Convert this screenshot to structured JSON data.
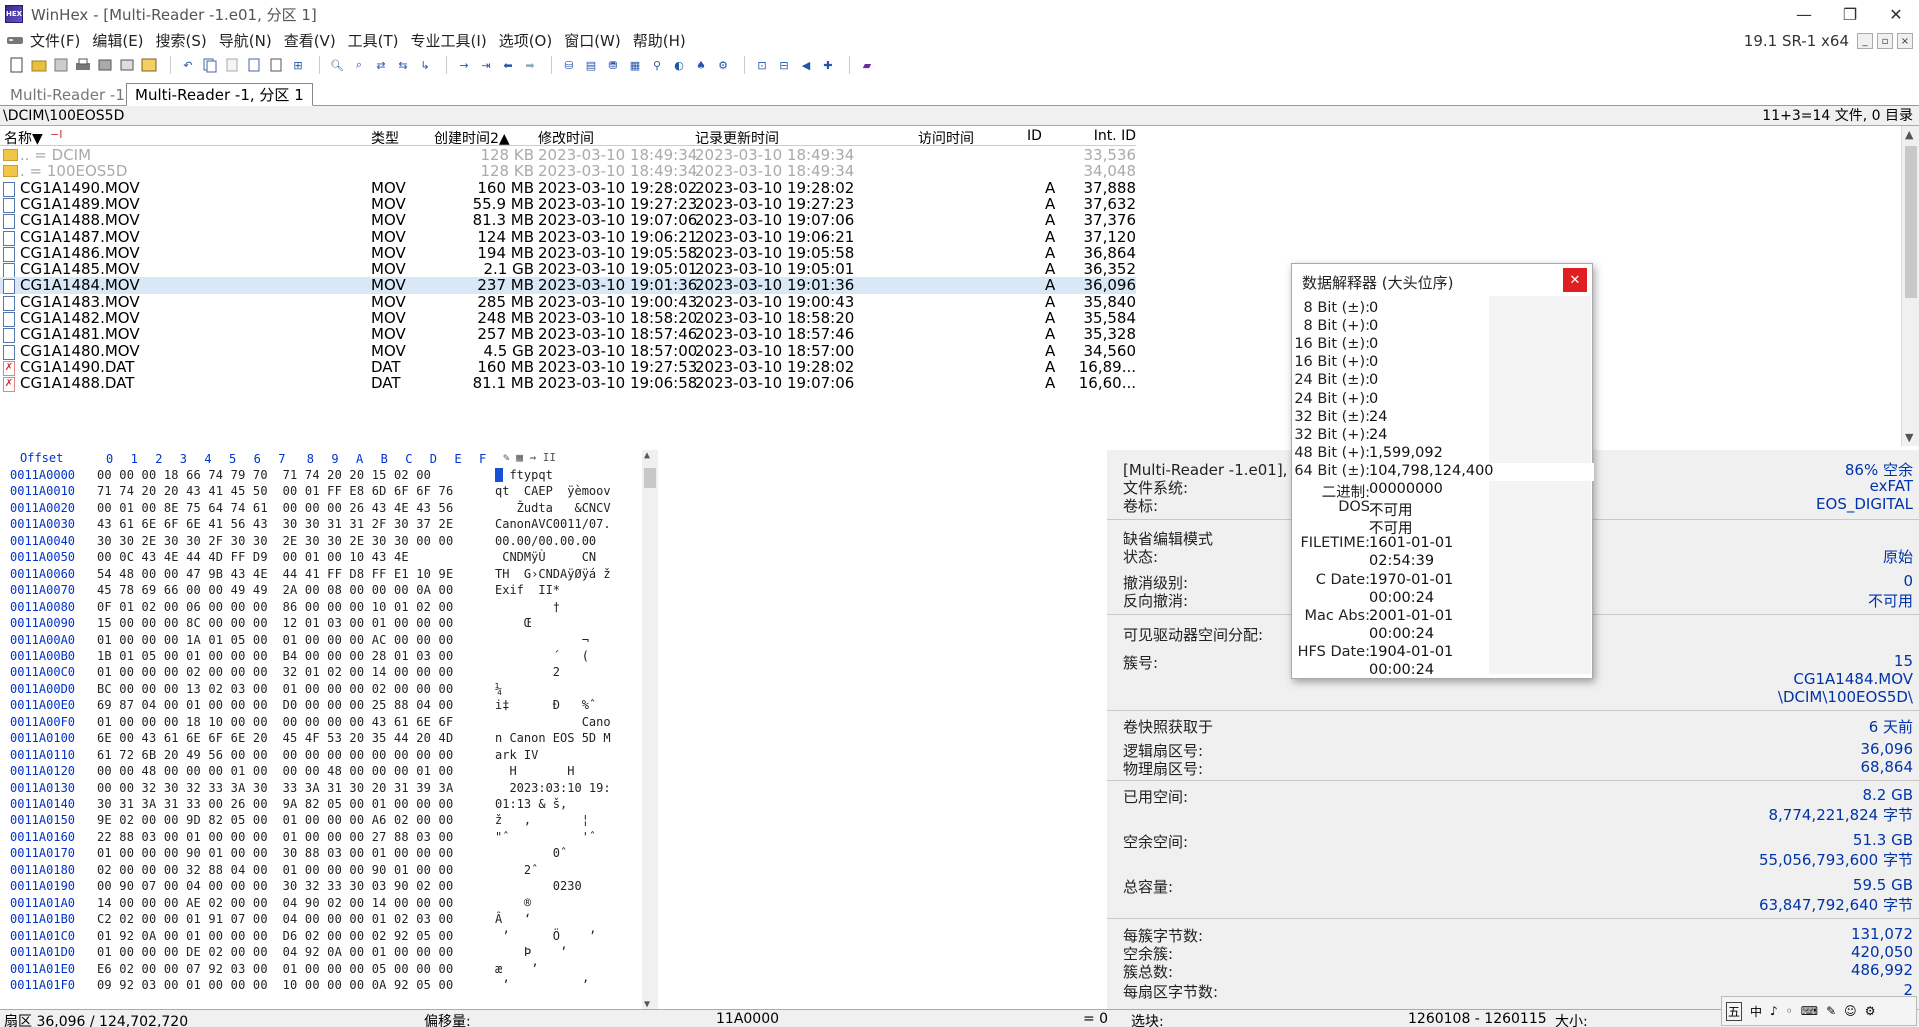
{
  "window": {
    "title": "WinHex - [Multi-Reader -1.e01, 分区 1]",
    "version": "19.1 SR-1 x64",
    "controls": {
      "minimize": "—",
      "restore": "❐",
      "close": "✕"
    }
  },
  "menu": [
    "文件(F)",
    "编辑(E)",
    "搜索(S)",
    "导航(N)",
    "查看(V)",
    "工具(T)",
    "专业工具(I)",
    "选项(O)",
    "窗口(W)",
    "帮助(H)"
  ],
  "tabs": [
    {
      "label": "Multi-Reader -1"
    },
    {
      "label": "Multi-Reader -1, 分区 1"
    }
  ],
  "pathbar": {
    "path": "\\DCIM\\100EOS5D",
    "summary": "11+3=14 文件, 0 目录"
  },
  "filelist": {
    "headers": {
      "name": "名称▼",
      "name_sort": "−I",
      "type": "类型",
      "created": "创建时间2▲",
      "modified": "修改时间",
      "record": "记录更新时间",
      "access": "访问时间",
      "id": "ID",
      "intid": "Int. ID"
    },
    "rows": [
      {
        "icon": "folder",
        "name": "..  =  DCIM",
        "type": "",
        "size": "128 KB",
        "modified": "2023-03-10  18:49:34",
        "record": "2023-03-10  18:49:34",
        "id": "",
        "intid": "33,536",
        "dim": true
      },
      {
        "icon": "folder",
        "name": ".   =  100EOS5D",
        "type": "",
        "size": "128 KB",
        "modified": "2023-03-10  18:49:34",
        "record": "2023-03-10  18:49:34",
        "id": "",
        "intid": "34,048",
        "dim": true
      },
      {
        "icon": "file",
        "name": "CG1A1490.MOV",
        "type": "MOV",
        "size": "160 MB",
        "modified": "2023-03-10  19:28:02",
        "record": "2023-03-10  19:28:02",
        "id": "A",
        "intid": "37,888"
      },
      {
        "icon": "file",
        "name": "CG1A1489.MOV",
        "type": "MOV",
        "size": "55.9 MB",
        "modified": "2023-03-10  19:27:23",
        "record": "2023-03-10  19:27:23",
        "id": "A",
        "intid": "37,632"
      },
      {
        "icon": "file",
        "name": "CG1A1488.MOV",
        "type": "MOV",
        "size": "81.3 MB",
        "modified": "2023-03-10  19:07:06",
        "record": "2023-03-10  19:07:06",
        "id": "A",
        "intid": "37,376"
      },
      {
        "icon": "file",
        "name": "CG1A1487.MOV",
        "type": "MOV",
        "size": "124 MB",
        "modified": "2023-03-10  19:06:21",
        "record": "2023-03-10  19:06:21",
        "id": "A",
        "intid": "37,120"
      },
      {
        "icon": "file",
        "name": "CG1A1486.MOV",
        "type": "MOV",
        "size": "194 MB",
        "modified": "2023-03-10  19:05:58",
        "record": "2023-03-10  19:05:58",
        "id": "A",
        "intid": "36,864"
      },
      {
        "icon": "file",
        "name": "CG1A1485.MOV",
        "type": "MOV",
        "size": "2.1 GB",
        "modified": "2023-03-10  19:05:01",
        "record": "2023-03-10  19:05:01",
        "id": "A",
        "intid": "36,352"
      },
      {
        "icon": "file",
        "name": "CG1A1484.MOV",
        "type": "MOV",
        "size": "237 MB",
        "modified": "2023-03-10  19:01:36",
        "record": "2023-03-10  19:01:36",
        "id": "A",
        "intid": "36,096",
        "selected": true
      },
      {
        "icon": "file",
        "name": "CG1A1483.MOV",
        "type": "MOV",
        "size": "285 MB",
        "modified": "2023-03-10  19:00:43",
        "record": "2023-03-10  19:00:43",
        "id": "A",
        "intid": "35,840"
      },
      {
        "icon": "file",
        "name": "CG1A1482.MOV",
        "type": "MOV",
        "size": "248 MB",
        "modified": "2023-03-10  18:58:20",
        "record": "2023-03-10  18:58:20",
        "id": "A",
        "intid": "35,584"
      },
      {
        "icon": "file",
        "name": "CG1A1481.MOV",
        "type": "MOV",
        "size": "257 MB",
        "modified": "2023-03-10  18:57:46",
        "record": "2023-03-10  18:57:46",
        "id": "A",
        "intid": "35,328"
      },
      {
        "icon": "file",
        "name": "CG1A1480.MOV",
        "type": "MOV",
        "size": "4.5 GB",
        "modified": "2023-03-10  18:57:00",
        "record": "2023-03-10  18:57:00",
        "id": "A",
        "intid": "34,560"
      },
      {
        "icon": "x",
        "name": "CG1A1490.DAT",
        "type": "DAT",
        "size": "160 MB",
        "modified": "2023-03-10  19:27:53",
        "record": "2023-03-10  19:28:02",
        "id": "A",
        "intid": "16,89..."
      },
      {
        "icon": "x",
        "name": "CG1A1488.DAT",
        "type": "DAT",
        "size": "81.1 MB",
        "modified": "2023-03-10  19:06:58",
        "record": "2023-03-10  19:07:06",
        "id": "A",
        "intid": "16,60..."
      }
    ]
  },
  "hex": {
    "header": {
      "offset": "Offset",
      "cols": [
        "0",
        "1",
        "2",
        "3",
        "4",
        "5",
        "6",
        "7",
        "8",
        "9",
        "A",
        "B",
        "C",
        "D",
        "E",
        "F"
      ]
    },
    "rows": [
      {
        "off": "0011A0000",
        "bytes": "00 00 00 18 66 74 79 70  71 74 20 20 15 02 00",
        "ascii": "  ftypqt"
      },
      {
        "off": "0011A0010",
        "bytes": "71 74 20 20 43 41 45 50  00 01 FF E8 6D 6F 6F 76",
        "ascii": "qt  CAEP  ÿèmoov"
      },
      {
        "off": "0011A0020",
        "bytes": "00 01 00 8E 75 64 74 61  00 00 00 26 43 4E 43 56",
        "ascii": "   Žudta   &CNCV"
      },
      {
        "off": "0011A0030",
        "bytes": "43 61 6E 6F 6E 41 56 43  30 30 31 31 2F 30 37 2E",
        "ascii": "CanonAVC0011/07."
      },
      {
        "off": "0011A0040",
        "bytes": "30 30 2E 30 30 2F 30 30  2E 30 30 2E 30 30 00 00",
        "ascii": "00.00/00.00.00"
      },
      {
        "off": "0011A0050",
        "bytes": "00 0C 43 4E 44 4D FF D9  00 01 00 10 43 4E",
        "ascii": " CNDMÿÙ     CN"
      },
      {
        "off": "0011A0060",
        "bytes": "54 48 00 00 47 9B 43 4E  44 41 FF D8 FF E1 10 9E",
        "ascii": "TH  G›CNDAÿØÿá ž"
      },
      {
        "off": "0011A0070",
        "bytes": "45 78 69 66 00 00 49 49  2A 00 08 00 00 00 0A 00",
        "ascii": "Exif  II*"
      },
      {
        "off": "0011A0080",
        "bytes": "0F 01 02 00 06 00 00 00  86 00 00 00 10 01 02 00",
        "ascii": "        †"
      },
      {
        "off": "0011A0090",
        "bytes": "15 00 00 00 8C 00 00 00  12 01 03 00 01 00 00 00",
        "ascii": "    Œ"
      },
      {
        "off": "0011A00A0",
        "bytes": "01 00 00 00 1A 01 05 00  01 00 00 00 AC 00 00 00",
        "ascii": "            ¬"
      },
      {
        "off": "0011A00B0",
        "bytes": "1B 01 05 00 01 00 00 00  B4 00 00 00 28 01 03 00",
        "ascii": "        ´   ("
      },
      {
        "off": "0011A00C0",
        "bytes": "01 00 00 00 02 00 00 00  32 01 02 00 14 00 00 00",
        "ascii": "        2"
      },
      {
        "off": "0011A00D0",
        "bytes": "BC 00 00 00 13 02 03 00  01 00 00 00 02 00 00 00",
        "ascii": "¼"
      },
      {
        "off": "0011A00E0",
        "bytes": "69 87 04 00 01 00 00 00  D0 00 00 00 25 88 04 00",
        "ascii": "i‡      Ð   %ˆ"
      },
      {
        "off": "0011A00F0",
        "bytes": "01 00 00 00 18 10 00 00  00 00 00 00 43 61 6E 6F",
        "ascii": "            Cano"
      },
      {
        "off": "0011A0100",
        "bytes": "6E 00 43 61 6E 6F 6E 20  45 4F 53 20 35 44 20 4D",
        "ascii": "n Canon EOS 5D M"
      },
      {
        "off": "0011A0110",
        "bytes": "61 72 6B 20 49 56 00 00  00 00 00 00 00 00 00 00",
        "ascii": "ark IV"
      },
      {
        "off": "0011A0120",
        "bytes": "00 00 48 00 00 00 01 00  00 00 48 00 00 00 01 00",
        "ascii": "  H       H"
      },
      {
        "off": "0011A0130",
        "bytes": "00 00 32 30 32 33 3A 30  33 3A 31 30 20 31 39 3A",
        "ascii": "  2023:03:10 19:"
      },
      {
        "off": "0011A0140",
        "bytes": "30 31 3A 31 33 00 26 00  9A 82 05 00 01 00 00 00",
        "ascii": "01:13 & š‚"
      },
      {
        "off": "0011A0150",
        "bytes": "9E 02 00 00 9D 82 05 00  01 00 00 00 A6 02 00 00",
        "ascii": "ž   ‚       ¦"
      },
      {
        "off": "0011A0160",
        "bytes": "22 88 03 00 01 00 00 00  01 00 00 00 27 88 03 00",
        "ascii": "\"ˆ          'ˆ"
      },
      {
        "off": "0011A0170",
        "bytes": "01 00 00 00 90 01 00 00  30 88 03 00 01 00 00 00",
        "ascii": "        0ˆ"
      },
      {
        "off": "0011A0180",
        "bytes": "02 00 00 00 32 88 04 00  01 00 00 00 90 01 00 00",
        "ascii": "    2ˆ"
      },
      {
        "off": "0011A0190",
        "bytes": "00 90 07 00 04 00 00 00  30 32 33 30 03 90 02 00",
        "ascii": "        0230"
      },
      {
        "off": "0011A01A0",
        "bytes": "14 00 00 00 AE 02 00 00  04 90 02 00 14 00 00 00",
        "ascii": "    ®"
      },
      {
        "off": "0011A01B0",
        "bytes": "C2 02 00 00 01 91 07 00  04 00 00 00 01 02 03 00",
        "ascii": "Â   ‘"
      },
      {
        "off": "0011A01C0",
        "bytes": "01 92 0A 00 01 00 00 00  D6 02 00 00 02 92 05 00",
        "ascii": " ’      Ö    ’"
      },
      {
        "off": "0011A01D0",
        "bytes": "01 00 00 00 DE 02 00 00  04 92 0A 00 01 00 00 00",
        "ascii": "    Þ    ’"
      },
      {
        "off": "0011A01E0",
        "bytes": "E6 02 00 00 07 92 03 00  01 00 00 00 05 00 00 00",
        "ascii": "æ    ’"
      },
      {
        "off": "0011A01F0",
        "bytes": "09 92 03 00 01 00 00 00  10 00 00 00 0A 92 05 00",
        "ascii": " ’          ’"
      }
    ]
  },
  "info": {
    "title": "[Multi-Reader -1.e01], 分",
    "free_pct": "86% 空余",
    "fs_label": "文件系统:",
    "fs_value": "exFAT",
    "vol_label": "卷标:",
    "vol_value": "EOS_DIGITAL",
    "mode_label": "缺省编辑模式",
    "state_label": "状态:",
    "state_value": "原始",
    "undo_label": "撤消级别:",
    "undo_value": "0",
    "redo_label": "反向撤消:",
    "redo_value": "不可用",
    "alloc_label": "可见驱动器空间分配:",
    "cluster_label": "簇号:",
    "cluster_value": "15",
    "cluster_file": "CG1A1484.MOV",
    "cluster_path": "\\DCIM\\100EOS5D\\",
    "snapshot_label": "卷快照获取于",
    "snapshot_value": "6 天前",
    "logical_label": "逻辑扇区号:",
    "logical_value": "36,096",
    "physical_label": "物理扇区号:",
    "physical_value": "68,864",
    "used_label": "已用空间:",
    "used_value": "8.2 GB",
    "used_bytes": "8,774,221,824 字节",
    "free_label": "空余空间:",
    "free_value": "51.3 GB",
    "free_bytes": "55,056,793,600 字节",
    "total_label": "总容量:",
    "total_value": "59.5 GB",
    "total_bytes": "63,847,792,640 字节",
    "bpc_label": "每簇字节数:",
    "bpc_value": "131,072",
    "freec_label": "空余簇:",
    "freec_value": "420,050",
    "totc_label": "簇总数:",
    "totc_value": "486,992",
    "bps_label": "每扇区字节数:",
    "bps_value": "2"
  },
  "dialog": {
    "title": "数据解释器 (大头位序)",
    "close": "✕",
    "rows": [
      {
        "label": "8 Bit (±):",
        "value": "0"
      },
      {
        "label": "8 Bit (+):",
        "value": "0"
      },
      {
        "label": "16 Bit (±):",
        "value": "0"
      },
      {
        "label": "16 Bit (+):",
        "value": "0"
      },
      {
        "label": "24 Bit (±):",
        "value": "0"
      },
      {
        "label": "24 Bit (+):",
        "value": "0"
      },
      {
        "label": "32 Bit (±):",
        "value": "24"
      },
      {
        "label": "32 Bit (+):",
        "value": "24"
      },
      {
        "label": "48 Bit (+):",
        "value": "1,599,092"
      },
      {
        "label": "64 Bit (±):",
        "value": "104,798,124,400"
      },
      {
        "label": "二进制:",
        "value": "00000000"
      },
      {
        "label": "DOS",
        "value": "不可用"
      },
      {
        "label": "",
        "value": "不可用"
      },
      {
        "label": "FILETIME:",
        "value": "1601-01-01"
      },
      {
        "label": "",
        "value": "02:54:39"
      },
      {
        "label": "C Date:",
        "value": "1970-01-01"
      },
      {
        "label": "",
        "value": "00:00:24"
      },
      {
        "label": "Mac Abs:",
        "value": "2001-01-01"
      },
      {
        "label": "",
        "value": "00:00:24"
      },
      {
        "label": "HFS Date:",
        "value": "1904-01-01"
      },
      {
        "label": "",
        "value": "00:00:24"
      }
    ]
  },
  "status": {
    "sector": "扇区 36,096 / 124,702,720",
    "offset_label": "偏移量:",
    "offset_value": "11A0000",
    "eq": "= 0",
    "sel_label": "选块:",
    "sel_value": "1260108 - 1260115",
    "size_label": "大小:"
  },
  "ime": [
    "五",
    "中",
    "♪",
    "◦",
    "⌨",
    "✎",
    "☺",
    "⚙"
  ]
}
